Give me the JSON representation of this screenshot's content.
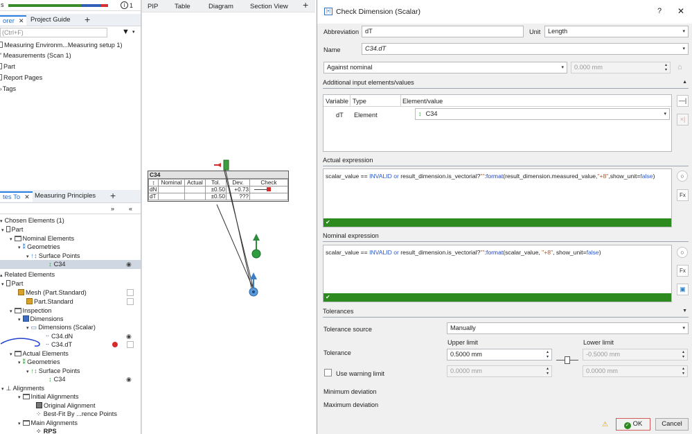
{
  "left": {
    "status_text": "s",
    "counter": "1",
    "tabs1": [
      {
        "label": "orer"
      },
      {
        "label": "Project Guide"
      }
    ],
    "search_placeholder": "(Ctrl+F)",
    "tree1": [
      {
        "label": "Measuring Environm...Measuring setup 1)"
      },
      {
        "label": "Measurements (Scan 1)"
      },
      {
        "label": "Part"
      },
      {
        "label": "Report Pages"
      },
      {
        "label": "Tags"
      }
    ],
    "tabs2": [
      {
        "label": "tes To"
      },
      {
        "label": "Measuring Principles"
      }
    ],
    "chosen_header": "Chosen Elements (1)",
    "chosen": [
      {
        "label": "Part"
      },
      {
        "label": "Nominal Elements"
      },
      {
        "label": "Geometries"
      },
      {
        "label": "Surface Points"
      },
      {
        "label": "C34"
      }
    ],
    "related_header": "Related Elements",
    "related": [
      {
        "label": "Part"
      },
      {
        "label": "Mesh (Part.Standard)"
      },
      {
        "label": "Part.Standard"
      },
      {
        "label": "Inspection"
      },
      {
        "label": "Dimensions"
      },
      {
        "label": "Dimensions (Scalar)"
      },
      {
        "label": "C34.dN"
      },
      {
        "label": "C34.dT"
      },
      {
        "label": "Actual Elements"
      },
      {
        "label": "Geometries"
      },
      {
        "label": "Surface Points"
      },
      {
        "label": "C34"
      },
      {
        "label": "Alignments"
      },
      {
        "label": "Initial Alignments"
      },
      {
        "label": "Original Alignment"
      },
      {
        "label": "Best-Fit By ...rence Points"
      },
      {
        "label": "Main Alignments"
      },
      {
        "label": "RPS"
      }
    ]
  },
  "mid": {
    "tabs": [
      {
        "label": "PIP"
      },
      {
        "label": "Table"
      },
      {
        "label": "Diagram"
      },
      {
        "label": "Section View"
      }
    ],
    "label_table": {
      "title": "C34",
      "headers": [
        "↕",
        "Nominal",
        "Actual",
        "Tol.",
        "Dev.",
        "Check"
      ],
      "rows": [
        [
          "dN",
          "",
          "",
          "±0.50",
          "+0.73",
          ""
        ],
        [
          "dT",
          "",
          "",
          "±0.50",
          "???",
          ""
        ]
      ]
    }
  },
  "dialog": {
    "title": "Check Dimension (Scalar)",
    "help": "?",
    "close": "✕",
    "abbreviation_label": "Abbreviation",
    "abbreviation_value": "dT",
    "unit_label": "Unit",
    "unit_value": "Length",
    "name_label": "Name",
    "name_value": "C34.dT",
    "check_mode": "Against nominal",
    "nominal_value": "0.000 mm",
    "additional_header": "Additional input elements/values",
    "var_headers": [
      "Variable",
      "Type",
      "Element/value"
    ],
    "var_row": {
      "variable": "dT",
      "type": "Element",
      "element": "C34"
    },
    "actual_header": "Actual expression",
    "nominal_header": "Nominal expression",
    "actual_expr": [
      {
        "t": "scalar_value == ",
        "c": ""
      },
      {
        "t": "INVALID",
        "c": "kw"
      },
      {
        "t": " or ",
        "c": "kw"
      },
      {
        "t": "result_dimension.is_vectorial",
        "c": ""
      },
      {
        "t": "?",
        "c": ""
      },
      {
        "t": "\"\"",
        "c": "str"
      },
      {
        "t": ":",
        "c": ""
      },
      {
        "t": "format",
        "c": "fn"
      },
      {
        "t": "(result_dimension.measured_value,",
        "c": ""
      },
      {
        "t": "\"+8\"",
        "c": "str"
      },
      {
        "t": ",show_unit=",
        "c": ""
      },
      {
        "t": "false",
        "c": "kw"
      },
      {
        "t": ")",
        "c": ""
      }
    ],
    "nominal_expr": [
      {
        "t": "scalar_value == ",
        "c": ""
      },
      {
        "t": "INVALID",
        "c": "kw"
      },
      {
        "t": " or ",
        "c": "kw"
      },
      {
        "t": "result_dimension.is_vectorial",
        "c": ""
      },
      {
        "t": "?",
        "c": ""
      },
      {
        "t": "\"\"",
        "c": "str"
      },
      {
        "t": ":",
        "c": ""
      },
      {
        "t": "format",
        "c": "fn"
      },
      {
        "t": "(scalar_value, ",
        "c": ""
      },
      {
        "t": "\"+8\"",
        "c": "str"
      },
      {
        "t": ", show_unit=",
        "c": ""
      },
      {
        "t": "false",
        "c": "kw"
      },
      {
        "t": ")",
        "c": ""
      }
    ],
    "tolerances_header": "Tolerances",
    "tol_source_label": "Tolerance source",
    "tol_source_value": "Manually",
    "upper_label": "Upper limit",
    "lower_label": "Lower limit",
    "tolerance_label": "Tolerance",
    "upper_value": "0.5000 mm",
    "lower_value": "-0.5000 mm",
    "warn_label": "Use warning limit",
    "warn_upper": "0.0000 mm",
    "warn_lower": "0.0000 mm",
    "min_dev_label": "Minimum deviation",
    "max_dev_label": "Maximum deviation",
    "ok_label": "OK",
    "cancel_label": "Cancel",
    "colors": {
      "accent": "#2a7de1",
      "valid": "#2c8a1e",
      "keyword": "#2b57c9",
      "string": "#b0531e"
    }
  }
}
